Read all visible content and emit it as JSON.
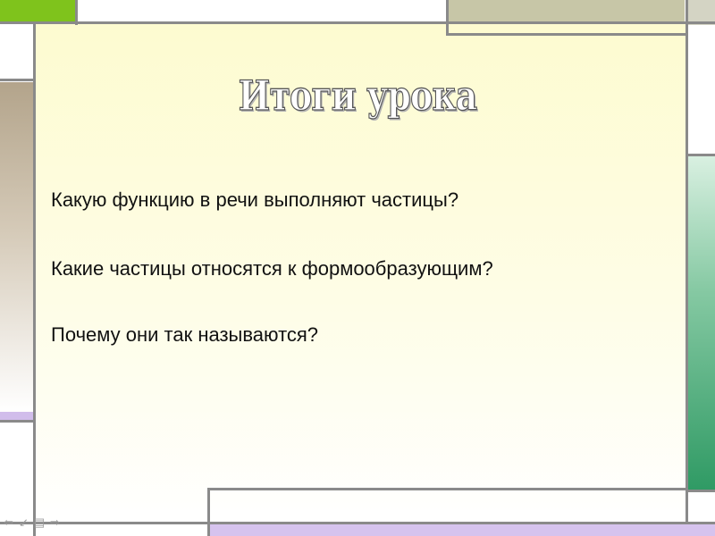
{
  "slide": {
    "title": "Итоги урока",
    "questions": [
      "Какую функцию в речи выполняют частицы?",
      "Какие частицы относятся к формообразующим?",
      "Почему они так называются?"
    ]
  },
  "navigation": {
    "prev_icon": "arrow-left-icon",
    "return_icon": "return-icon",
    "menu_icon": "slides-menu-icon",
    "next_icon": "arrow-right-icon"
  },
  "colors": {
    "accent_green": "#7fc31c",
    "panel_yellow": "#fdfbd0",
    "teal_green": "#2f9a64",
    "lavender": "#c9b5e6",
    "khaki": "#c7c6a7",
    "border_gray": "#8a8a8a"
  }
}
